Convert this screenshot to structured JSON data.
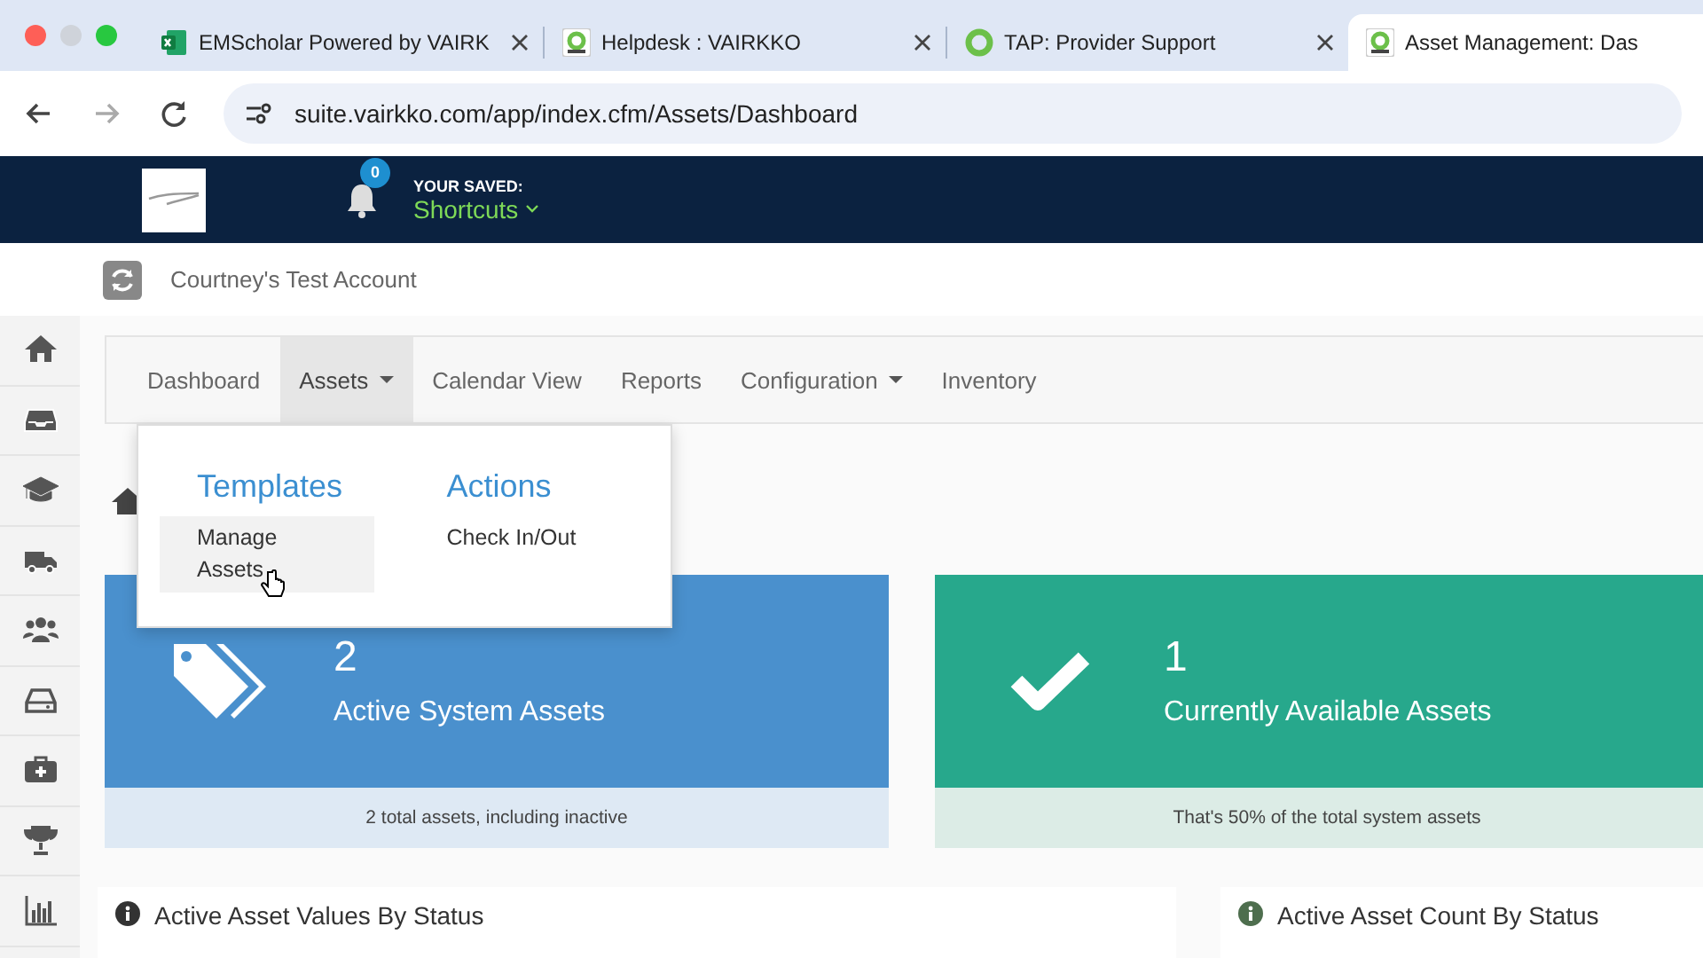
{
  "browser": {
    "tabs": [
      {
        "title": "EMScholar Powered by VAIRK",
        "selected": false
      },
      {
        "title": "Helpdesk : VAIRKKO",
        "selected": false
      },
      {
        "title": "TAP: Provider Support",
        "selected": false
      },
      {
        "title": "Asset Management: Das",
        "selected": true
      }
    ],
    "address": "suite.vairkko.com/app/index.cfm/Assets/Dashboard"
  },
  "header": {
    "notifications": "0",
    "saved_label": "YOUR SAVED:",
    "shortcuts": "Shortcuts"
  },
  "account": "Courtney's Test Account",
  "nav": [
    {
      "label": "Dashboard",
      "selected": false,
      "dropdown": false
    },
    {
      "label": "Assets",
      "selected": true,
      "dropdown": true
    },
    {
      "label": "Calendar View",
      "selected": false,
      "dropdown": false
    },
    {
      "label": "Reports",
      "selected": false,
      "dropdown": false
    },
    {
      "label": "Configuration",
      "selected": false,
      "dropdown": true
    },
    {
      "label": "Inventory",
      "selected": false,
      "dropdown": false
    }
  ],
  "dropdown": {
    "columns": [
      {
        "heading": "Templates",
        "items": [
          {
            "label": "Manage Assets",
            "selected": true
          }
        ]
      },
      {
        "heading": "Actions",
        "items": [
          {
            "label": "Check In/Out",
            "selected": false
          }
        ]
      }
    ]
  },
  "cards": [
    {
      "kind": "tags",
      "value": "2",
      "label": "Active System Assets",
      "footer": "2 total assets, including inactive"
    },
    {
      "kind": "check",
      "value": "1",
      "label": "Currently Available Assets",
      "footer": "That's 50% of the total system assets"
    }
  ],
  "panels": [
    {
      "title": "Active Asset Values By Status"
    },
    {
      "title": "Active Asset Count By Status"
    }
  ]
}
